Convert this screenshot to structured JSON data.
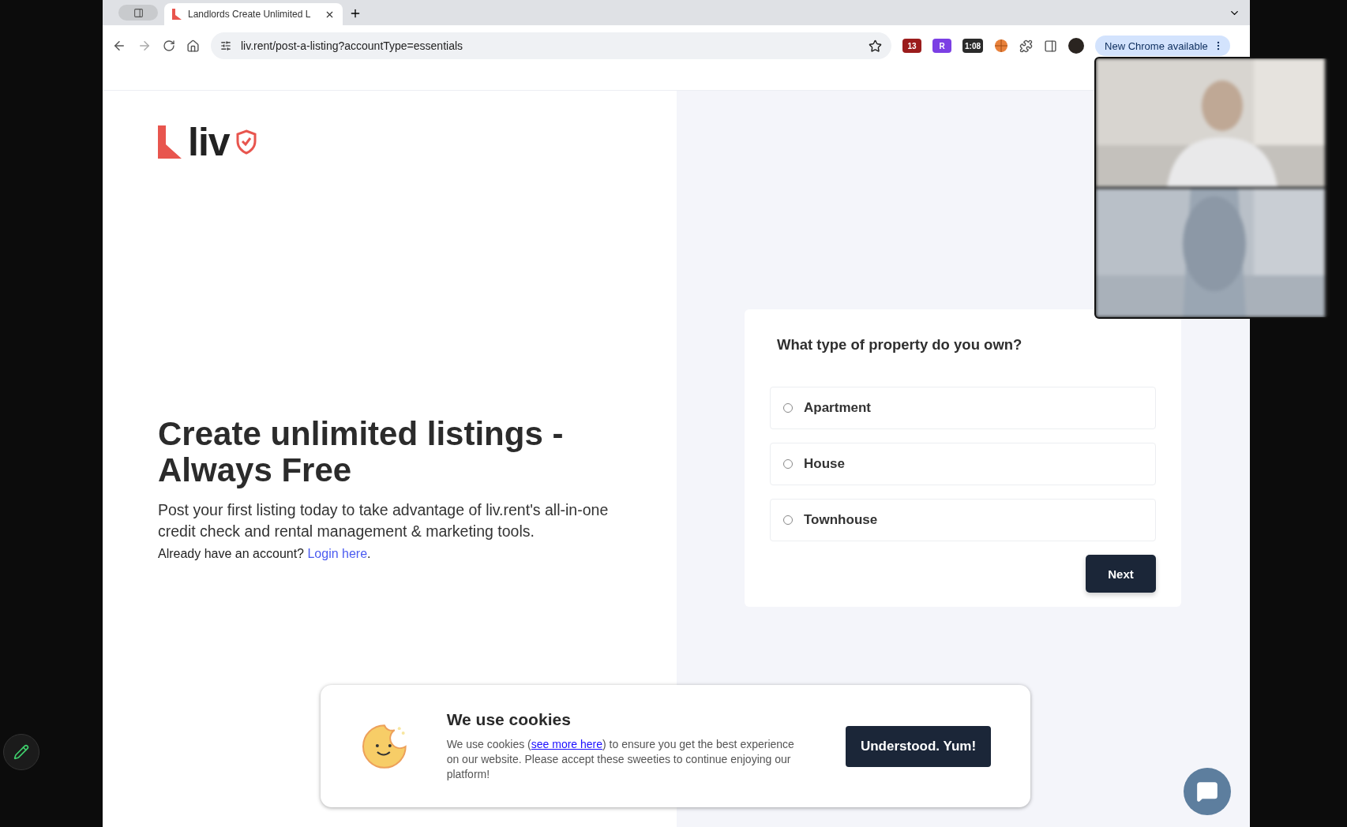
{
  "browser": {
    "tab_title": "Landlords Create Unlimited L",
    "url": "liv.rent/post-a-listing?accountType=essentials",
    "extension_badges": [
      "13",
      "R",
      "1:08"
    ],
    "update_button": "New Chrome available"
  },
  "brand": {
    "logo": "liv"
  },
  "hero": {
    "heading": "Create unlimited listings - Always Free",
    "description": "Post your first listing today to take advantage of liv.rent's all-in-one credit check and rental management & marketing tools.",
    "login_prefix": "Already have an account?",
    "login_link": "Login here",
    "login_suffix": "."
  },
  "question": {
    "title": "What type of property do you own?",
    "options": [
      {
        "label": "Apartment",
        "selected": false
      },
      {
        "label": "House",
        "selected": false
      },
      {
        "label": "Townhouse",
        "selected": false
      }
    ],
    "next_button": "Next"
  },
  "cookie_banner": {
    "title": "We use cookies",
    "text_before": "We use cookies (",
    "link": "see more here",
    "text_after": ") to ensure you get the best experience on our website. Please accept these sweeties to continue enjoying our platform!",
    "button": "Understood. Yum!"
  }
}
